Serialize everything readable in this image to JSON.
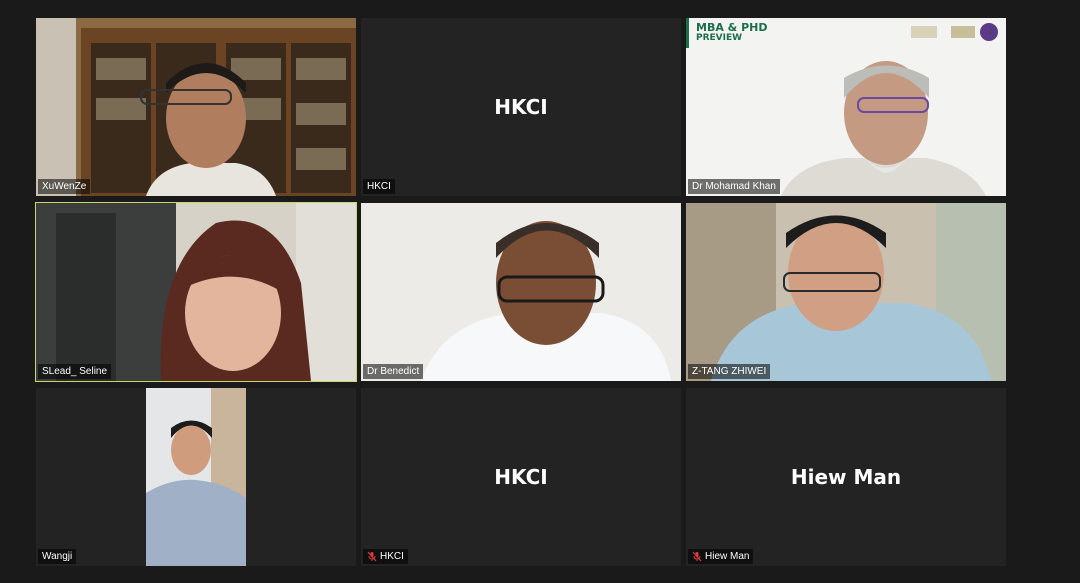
{
  "participants": [
    {
      "id": "t1",
      "name": "XuWenZe",
      "video": true,
      "muted": false,
      "active": false
    },
    {
      "id": "t2",
      "name": "HKCI",
      "display": "HKCI",
      "video": false,
      "muted": false,
      "active": false
    },
    {
      "id": "t3",
      "name": "Dr Mohamad Khan",
      "video": true,
      "muted": false,
      "active": false,
      "banner": {
        "title": "MBA & PHD",
        "subtitle": "PREVIEW"
      }
    },
    {
      "id": "t4",
      "name": "SLead_ Seline",
      "video": true,
      "muted": false,
      "active": true
    },
    {
      "id": "t5",
      "name": "Dr Benedict",
      "video": true,
      "muted": false,
      "active": false
    },
    {
      "id": "t6",
      "name": "Z-TANG ZHIWEI",
      "video": true,
      "muted": false,
      "active": false
    },
    {
      "id": "t7",
      "name": "Wangji",
      "video": true,
      "muted": false,
      "active": false
    },
    {
      "id": "t8",
      "name": "HKCI",
      "display": "HKCI",
      "video": false,
      "muted": true,
      "active": false
    },
    {
      "id": "t9",
      "name": "Hiew Man",
      "display": "Hiew Man",
      "video": false,
      "muted": true,
      "active": false
    }
  ],
  "colors": {
    "background": "#1a1a1a",
    "tile": "#232323",
    "active_border": "#c9d66a",
    "mute_icon": "#e0383e"
  },
  "icons": {
    "mute": "microphone-muted-icon"
  }
}
